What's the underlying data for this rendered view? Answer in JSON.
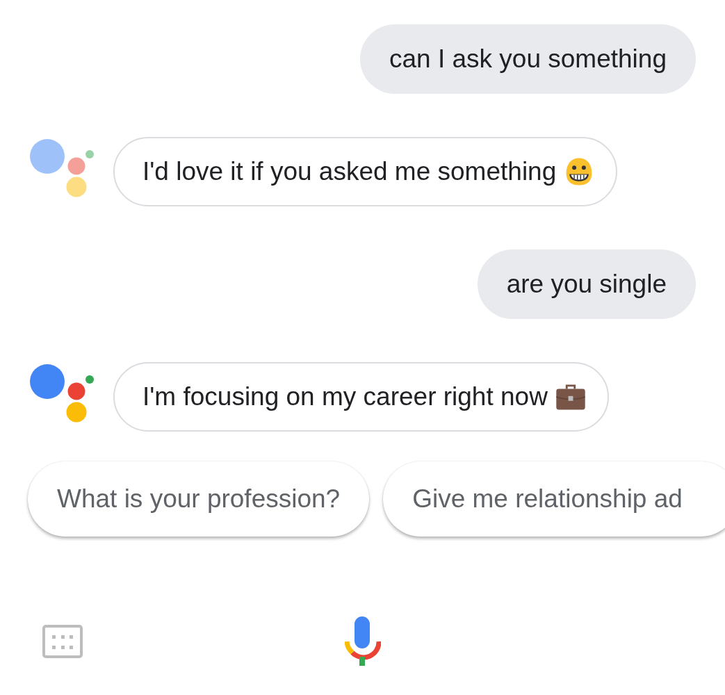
{
  "messages": [
    {
      "kind": "user",
      "text": "can I ask you something"
    },
    {
      "kind": "assistant",
      "text": "I'd love it if you asked me something",
      "emoji": {
        "kind": "grin"
      },
      "active": false
    },
    {
      "kind": "user",
      "text": "are you single"
    },
    {
      "kind": "assistant",
      "text": "I'm focusing on my career right now",
      "emoji": {
        "kind": "briefcase"
      },
      "active": true
    }
  ],
  "suggestions": [
    "What is your profession?",
    "Give me relationship ad"
  ]
}
